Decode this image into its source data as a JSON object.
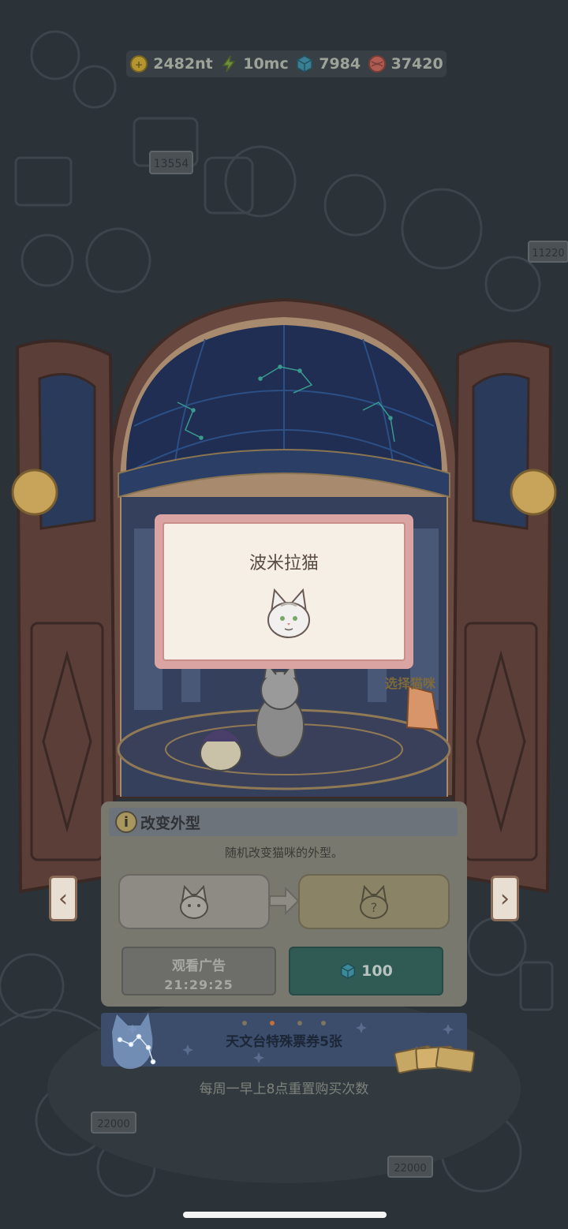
{
  "resources": [
    {
      "icon": "coin-icon",
      "value": "2482nt",
      "color": "#c9a53b"
    },
    {
      "icon": "lightning-icon",
      "value": "10mc",
      "color": "#7da640"
    },
    {
      "icon": "gem-cube-icon",
      "value": "7984",
      "color": "#3f8fa8"
    },
    {
      "icon": "yarn-ball-icon",
      "value": "37420",
      "color": "#c46a5e"
    }
  ],
  "background_signs": [
    "13554",
    "11220",
    "22000",
    "22000"
  ],
  "result_popup": {
    "title": "波米拉猫",
    "icon": "cat-face-icon"
  },
  "select_cat_label": "选择猫咪",
  "panel": {
    "title": "改变外型",
    "description": "随机改变猫咪的外型。",
    "compare": {
      "current_icon": "cat-silhouette-icon",
      "arrow_icon": "arrow-right-icon",
      "new_icon": "unknown-cat-icon"
    },
    "watch_ad_label": "观看广告",
    "watch_ad_timer": "21:29:25",
    "buy_price": "100",
    "buy_currency_icon": "gem-cube-icon"
  },
  "nav": {
    "prev": "‹",
    "next": "›"
  },
  "ticket_banner": {
    "text": "天文台特殊票券5张",
    "pages": 3,
    "active_page": 1
  },
  "reset_note": "每周一早上8点重置购买次数",
  "colors": {
    "background": "#2b3238",
    "panel": "#78786f",
    "buy_button": "#2f5b54",
    "popup_border": "#d9a4a1"
  }
}
